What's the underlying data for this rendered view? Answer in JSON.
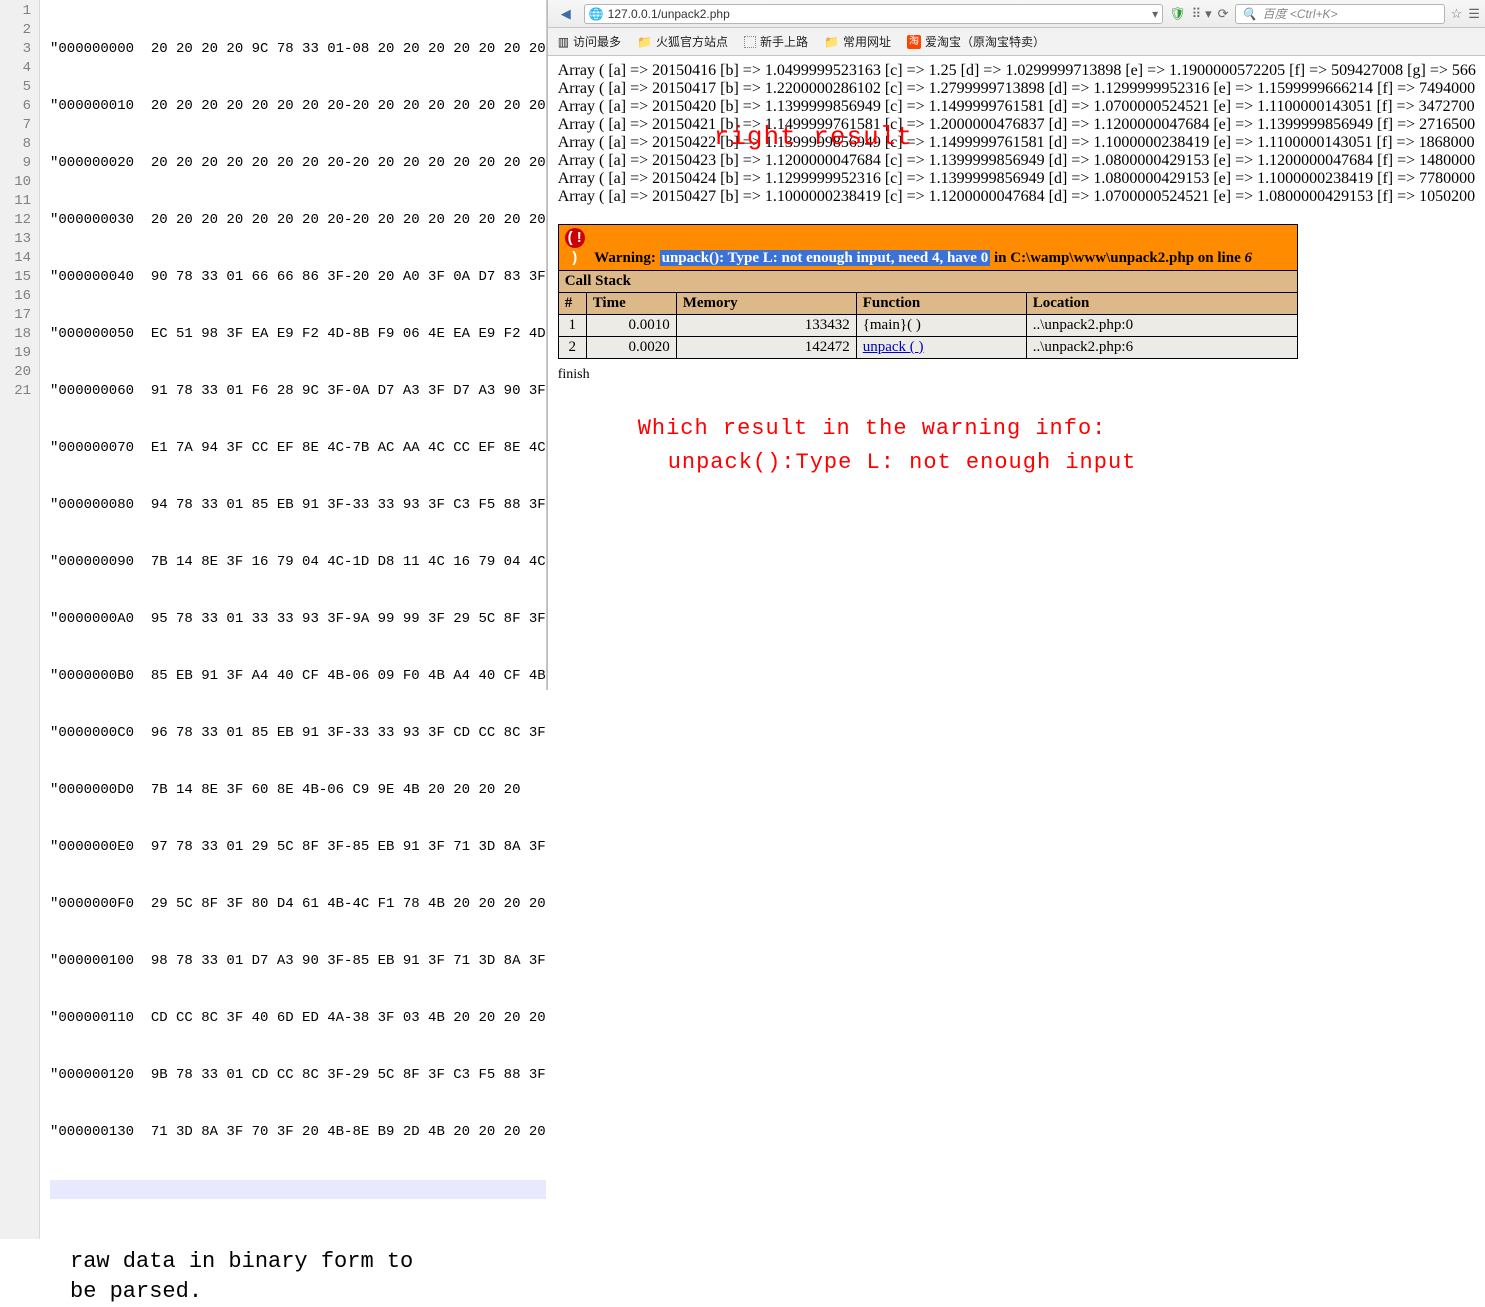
{
  "editor": {
    "line_numbers": [
      "1",
      "2",
      "3",
      "4",
      "5",
      "6",
      "7",
      "8",
      "9",
      "10",
      "11",
      "12",
      "13",
      "14",
      "15",
      "16",
      "17",
      "18",
      "19",
      "20",
      "21"
    ],
    "lines": [
      "\"000000000  20 20 20 20 9C 78 33 01-08 20 20 20 20 20 20 20",
      "\"000000010  20 20 20 20 20 20 20 20-20 20 20 20 20 20 20 20",
      "\"000000020  20 20 20 20 20 20 20 20-20 20 20 20 20 20 20 20",
      "\"000000030  20 20 20 20 20 20 20 20-20 20 20 20 20 20 20 20",
      "\"000000040  90 78 33 01 66 66 86 3F-20 20 A0 3F 0A D7 83 3F",
      "\"000000050  EC 51 98 3F EA E9 F2 4D-8B F9 06 4E EA E9 F2 4D",
      "\"000000060  91 78 33 01 F6 28 9C 3F-0A D7 A3 3F D7 A3 90 3F",
      "\"000000070  E1 7A 94 3F CC EF 8E 4C-7B AC AA 4C CC EF 8E 4C",
      "\"000000080  94 78 33 01 85 EB 91 3F-33 33 93 3F C3 F5 88 3F",
      "\"000000090  7B 14 8E 3F 16 79 04 4C-1D D8 11 4C 16 79 04 4C",
      "\"0000000A0  95 78 33 01 33 33 93 3F-9A 99 99 3F 29 5C 8F 3F",
      "\"0000000B0  85 EB 91 3F A4 40 CF 4B-06 09 F0 4B A4 40 CF 4B",
      "\"0000000C0  96 78 33 01 85 EB 91 3F-33 33 93 3F CD CC 8C 3F",
      "\"0000000D0  7B 14 8E 3F 60 8E 4B-06 C9 9E 4B 20 20 20 20",
      "\"0000000E0  97 78 33 01 29 5C 8F 3F-85 EB 91 3F 71 3D 8A 3F",
      "\"0000000F0  29 5C 8F 3F 80 D4 61 4B-4C F1 78 4B 20 20 20 20",
      "\"000000100  98 78 33 01 D7 A3 90 3F-85 EB 91 3F 71 3D 8A 3F",
      "\"000000110  CD CC 8C 3F 40 6D ED 4A-38 3F 03 4B 20 20 20 20",
      "\"000000120  9B 78 33 01 CD CC 8C 3F-29 5C 8F 3F C3 F5 88 3F",
      "\"000000130  71 3D 8A 3F 70 3F 20 4B-8E B9 2D 4B 20 20 20 20",
      ""
    ],
    "annotation_line1": "raw data in binary form to",
    "annotation_line2": "be parsed."
  },
  "browser": {
    "url": "127.0.0.1/unpack2.php",
    "search_placeholder": "百度 <Ctrl+K>",
    "bookmarks": {
      "most_visited": "访问最多",
      "firefox_site": "火狐官方站点",
      "getting_started": "新手上路",
      "common_sites": "常用网址",
      "aitaobao": "爱淘宝（原淘宝特卖）"
    }
  },
  "arrays": [
    "Array ( [a] => 20150416 [b] => 1.0499999523163 [c] => 1.25 [d] => 1.0299999713898 [e] => 1.1900000572205 [f] => 509427008 [g] => 566",
    "Array ( [a] => 20150417 [b] => 1.2200000286102 [c] => 1.2799999713898 [d] => 1.1299999952316 [e] => 1.1599999666214 [f] => 7494000",
    "Array ( [a] => 20150420 [b] => 1.1399999856949 [c] => 1.1499999761581 [d] => 1.0700000524521 [e] => 1.1100000143051 [f] => 3472700",
    "Array ( [a] => 20150421 [b] => 1.1499999761581 [c] => 1.2000000476837 [d] => 1.1200000047684 [e] => 1.1399999856949 [f] => 2716500",
    "Array ( [a] => 20150422 [b] => 1.1399999856949 [c] => 1.1499999761581 [d] => 1.1000000238419 [e] => 1.1100000143051 [f] => 1868000",
    "Array ( [a] => 20150423 [b] => 1.1200000047684 [c] => 1.1399999856949 [d] => 1.0800000429153 [e] => 1.1200000047684 [f] => 1480000",
    "Array ( [a] => 20150424 [b] => 1.1299999952316 [c] => 1.1399999856949 [d] => 1.0800000429153 [e] => 1.1000000238419 [f] => 7780000",
    "Array ( [a] => 20150427 [b] => 1.1000000238419 [c] => 1.1200000047684 [d] => 1.0700000524521 [e] => 1.0800000429153 [f] => 1050200"
  ],
  "overlay_right_result": "right result",
  "xdebug": {
    "warning_prefix": "Warning: ",
    "warning_msg": "unpack(): Type L: not enough input, need 4, have 0",
    "warning_suffix_in": " in ",
    "warning_file": "C:\\wamp\\www\\unpack2.php",
    "warning_online": " on line ",
    "warning_line": "6",
    "callstack_label": "Call Stack",
    "hdr_num": "#",
    "hdr_time": "Time",
    "hdr_memory": "Memory",
    "hdr_function": "Function",
    "hdr_location": "Location",
    "rows": [
      {
        "n": "1",
        "time": "0.0010",
        "mem": "133432",
        "fn": "{main}( )",
        "fn_link": false,
        "loc": "..\\unpack2.php:0"
      },
      {
        "n": "2",
        "time": "0.0020",
        "mem": "142472",
        "fn": "unpack ( )",
        "fn_link": true,
        "loc": "..\\unpack2.php:6"
      }
    ]
  },
  "finish": "finish",
  "bottom_annot_line1": "Which result in the warning info:",
  "bottom_annot_line2": "unpack():Type L: not enough input"
}
